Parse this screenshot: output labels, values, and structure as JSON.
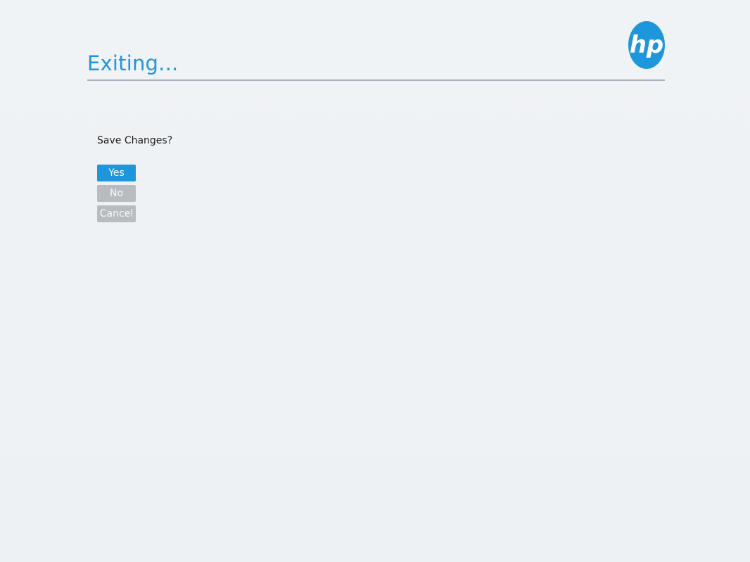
{
  "header": {
    "title": "Exiting...",
    "logo_icon": "hp-logo-icon"
  },
  "dialog": {
    "question": "Save Changes?",
    "options": [
      {
        "label": "Yes",
        "selected": true
      },
      {
        "label": "No",
        "selected": false
      },
      {
        "label": "Cancel",
        "selected": false
      }
    ]
  },
  "colors": {
    "accent": "#1e96dc",
    "button_inactive": "#b8bcc0",
    "background": "#eef2f4",
    "rule": "#aab0ba"
  }
}
